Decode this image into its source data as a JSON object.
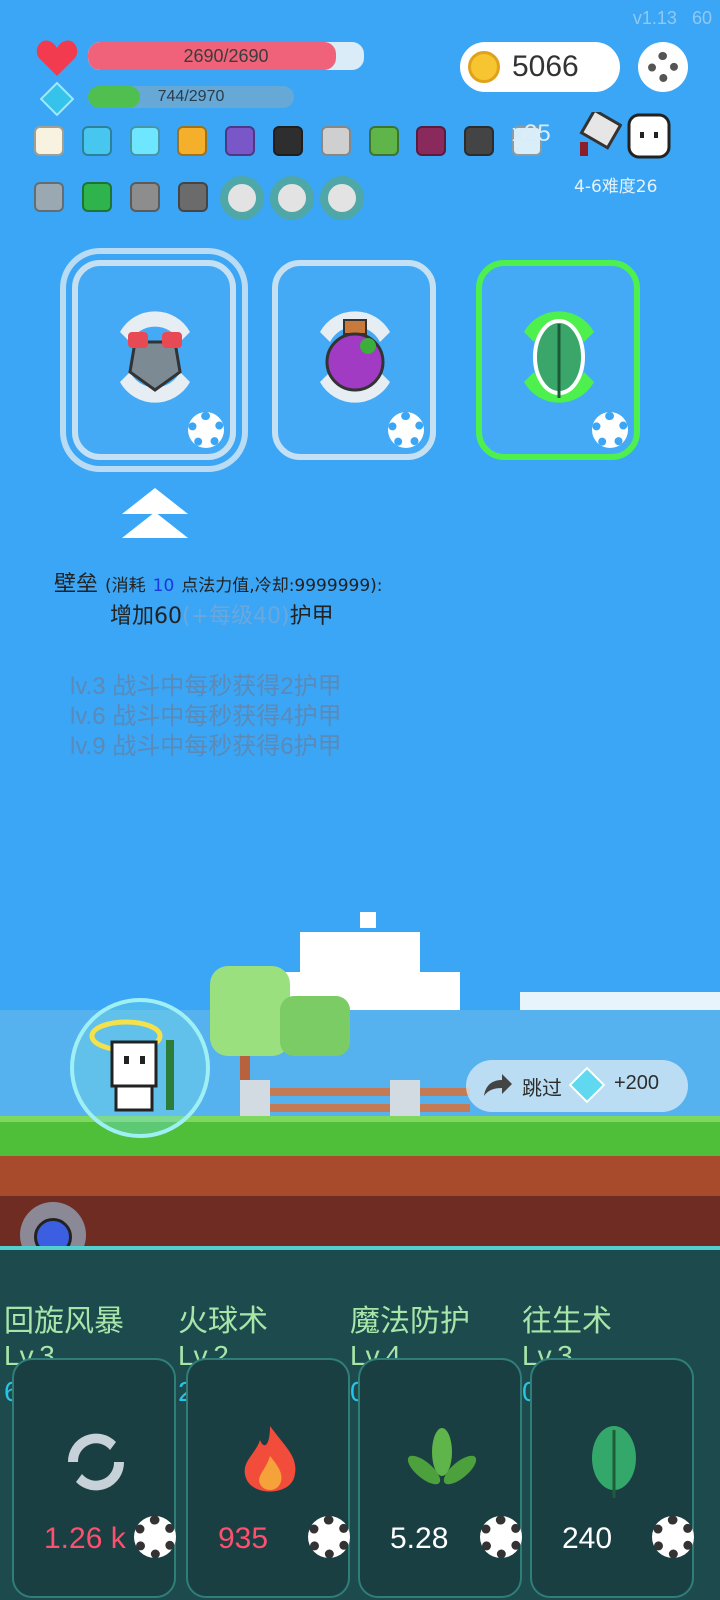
{
  "version": "v1.13",
  "fps": "60",
  "hp": {
    "text": "2690/2690",
    "fill": 0.9,
    "color": "#f0627a"
  },
  "mana": {
    "text": "744/2970",
    "fill": 0.25,
    "color": "#4fc04f"
  },
  "gold": "5066",
  "multiplier": "x25",
  "stage": "4-6难度26",
  "items_row1": [
    "egg-icon",
    "crystal-icon",
    "diamond-icon",
    "trophy-icon",
    "wizard-hat-icon",
    "cauldron-icon",
    "hook-icon",
    "sapling-icon",
    "spellbook-icon",
    "bat-icon",
    "orb-icon"
  ],
  "items_row2": [
    "sword-icon",
    "emerald-icon",
    "spikeball-icon",
    "mortar-icon",
    "ring-icon",
    "ring-icon",
    "ring-icon"
  ],
  "cards": [
    {
      "name": "shield-armor-card",
      "selected": true
    },
    {
      "name": "purple-potion-card",
      "selected": false
    },
    {
      "name": "green-leaf-card",
      "selected": false
    }
  ],
  "skill_desc": {
    "name": "壁垒",
    "cost_prefix": "(消耗",
    "cost_value": "10",
    "cost_suffix": "点法力值,冷却:9999999):",
    "effect_prefix": "增加60",
    "effect_scaling": "(+每级40)",
    "effect_suffix": "护甲",
    "levels": [
      "lv.3 战斗中每秒获得2护甲",
      "lv.6 战斗中每秒获得4护甲",
      "lv.9 战斗中每秒获得6护甲"
    ]
  },
  "skip": {
    "label": "跳过",
    "reward": "+200"
  },
  "skills": [
    {
      "name": "回旋风暴",
      "level": "Lv.3",
      "cost": "60",
      "value": "1.26 k",
      "value_color": "#ff4f6e"
    },
    {
      "name": "火球术",
      "level": "Lv.2",
      "cost": "20",
      "value": "935",
      "value_color": "#ff4f6e"
    },
    {
      "name": "魔法防护",
      "level": "Lv.4",
      "cost": "0",
      "value": "5.28",
      "value_color": "#ffffff"
    },
    {
      "name": "往生术",
      "level": "Lv.3",
      "cost": "0",
      "value": "240",
      "value_color": "#ffffff"
    }
  ]
}
